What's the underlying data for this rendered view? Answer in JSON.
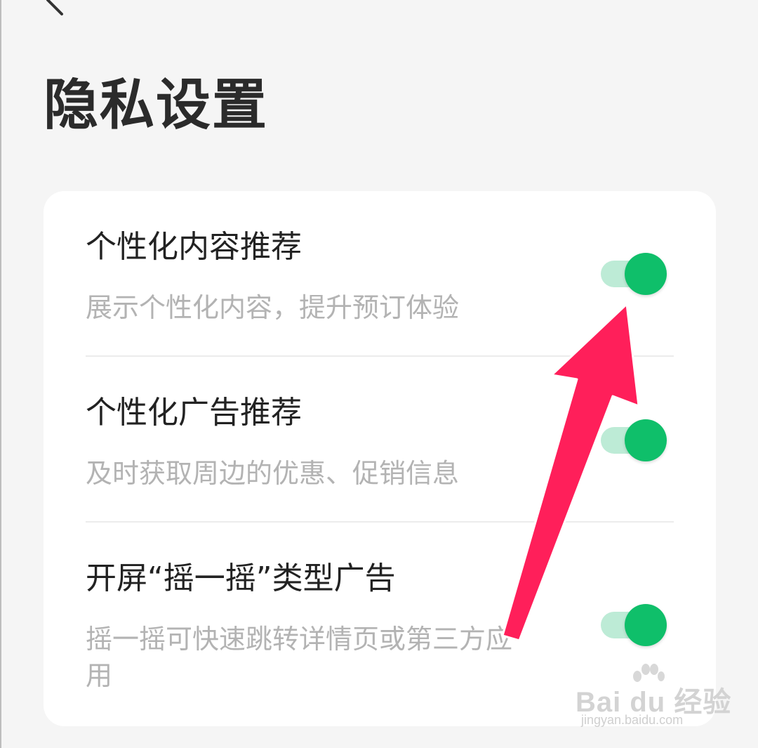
{
  "header": {
    "back_icon": "chevron-left-icon",
    "title": "隐私设置"
  },
  "settings": [
    {
      "title": "个性化内容推荐",
      "subtitle": "展示个性化内容，提升预订体验",
      "enabled": true
    },
    {
      "title": "个性化广告推荐",
      "subtitle": "及时获取周边的优惠、促销信息",
      "enabled": true
    },
    {
      "title": "开屏“摇一摇”类型广告",
      "subtitle": "摇一摇可快速跳转详情页或第三方应用",
      "enabled": true
    }
  ],
  "annotation": {
    "icon": "arrow-pointer-icon",
    "color": "#ff1f5a"
  },
  "watermark": {
    "logo_text": "Bai du 经验",
    "url": "jingyan.baidu.com"
  },
  "colors": {
    "toggle_on": "#0fbf6a",
    "toggle_track": "#bdebd6",
    "background": "#f5f5f5",
    "card": "#ffffff"
  }
}
